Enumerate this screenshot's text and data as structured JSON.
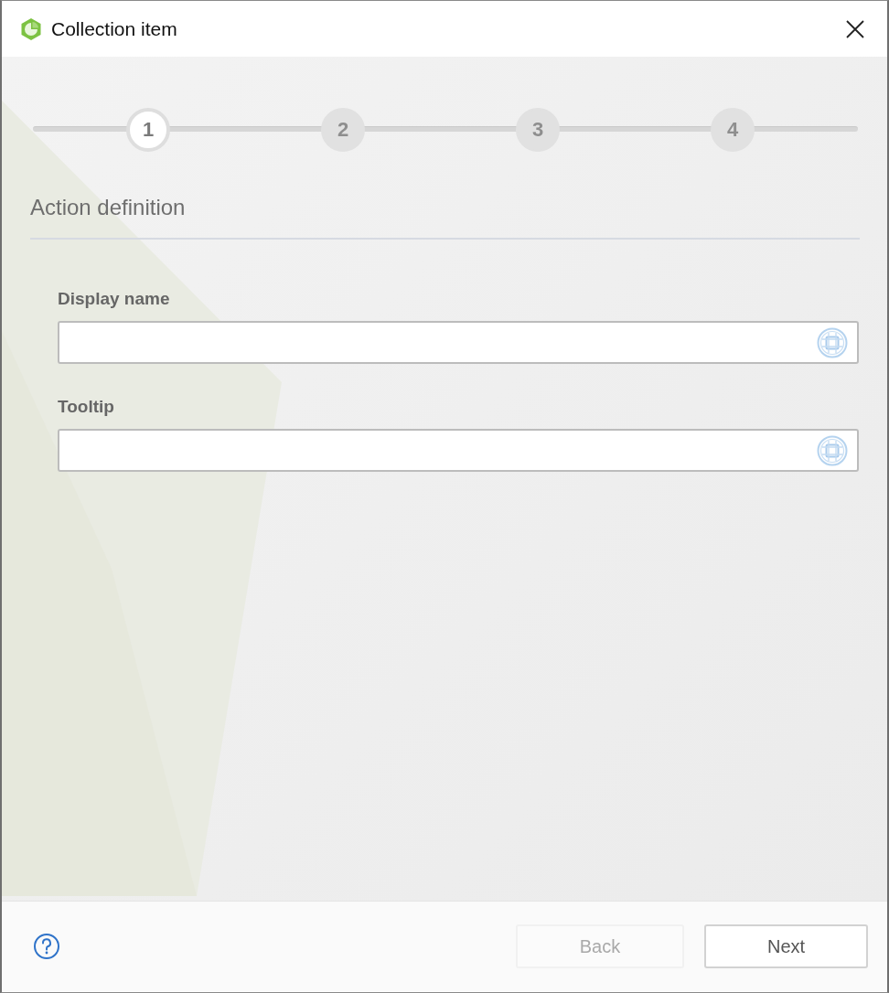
{
  "window": {
    "title": "Collection item"
  },
  "steps": [
    {
      "label": "1",
      "selected": true
    },
    {
      "label": "2",
      "selected": false
    },
    {
      "label": "3",
      "selected": false
    },
    {
      "label": "4",
      "selected": false
    }
  ],
  "section": {
    "title": "Action definition"
  },
  "fields": [
    {
      "label": "Display name"
    },
    {
      "label": "Tooltip"
    }
  ],
  "footer": {
    "buttons": [
      {
        "label": "Back",
        "disabled": true
      },
      {
        "label": "Next",
        "disabled": false
      }
    ]
  }
}
